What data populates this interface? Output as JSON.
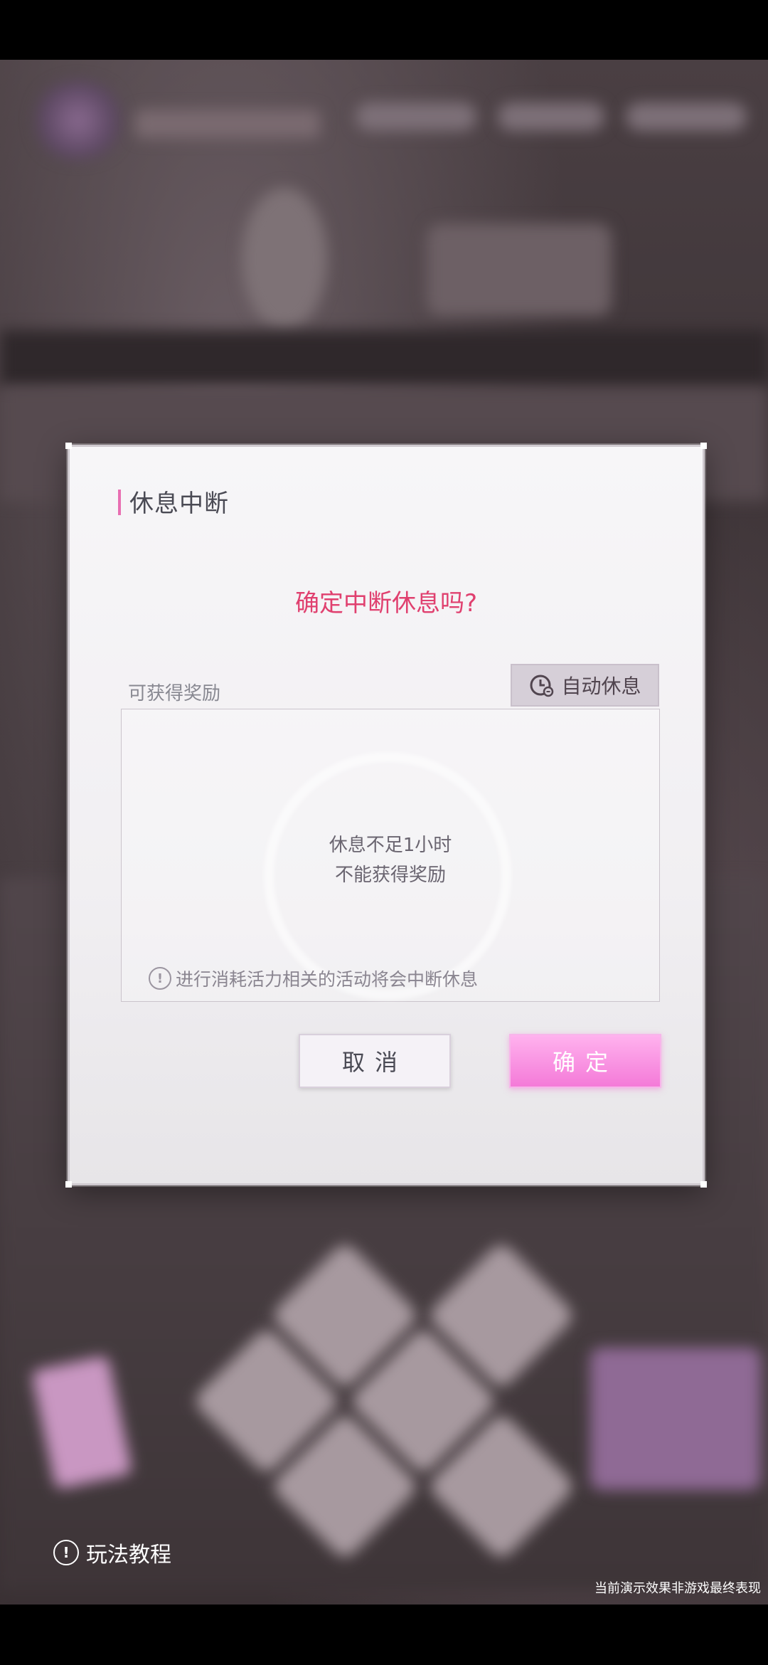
{
  "dialog": {
    "title": "休息中断",
    "question": "确定中断休息吗?",
    "reward_label": "可获得奖励",
    "auto_rest_label": "自动休息",
    "empty_line1": "休息不足1小时",
    "empty_line2": "不能获得奖励",
    "warning": "进行消耗活力相关的活动将会中断休息",
    "cancel_label": "取消",
    "confirm_label": "确定"
  },
  "footer": {
    "tutorial_label": "玩法教程",
    "disclaimer": "当前演示效果非游戏最终表现"
  },
  "colors": {
    "accent": "#e0406f",
    "confirm_pink": "#f47ad8",
    "title_bar": "#e86fb2"
  }
}
